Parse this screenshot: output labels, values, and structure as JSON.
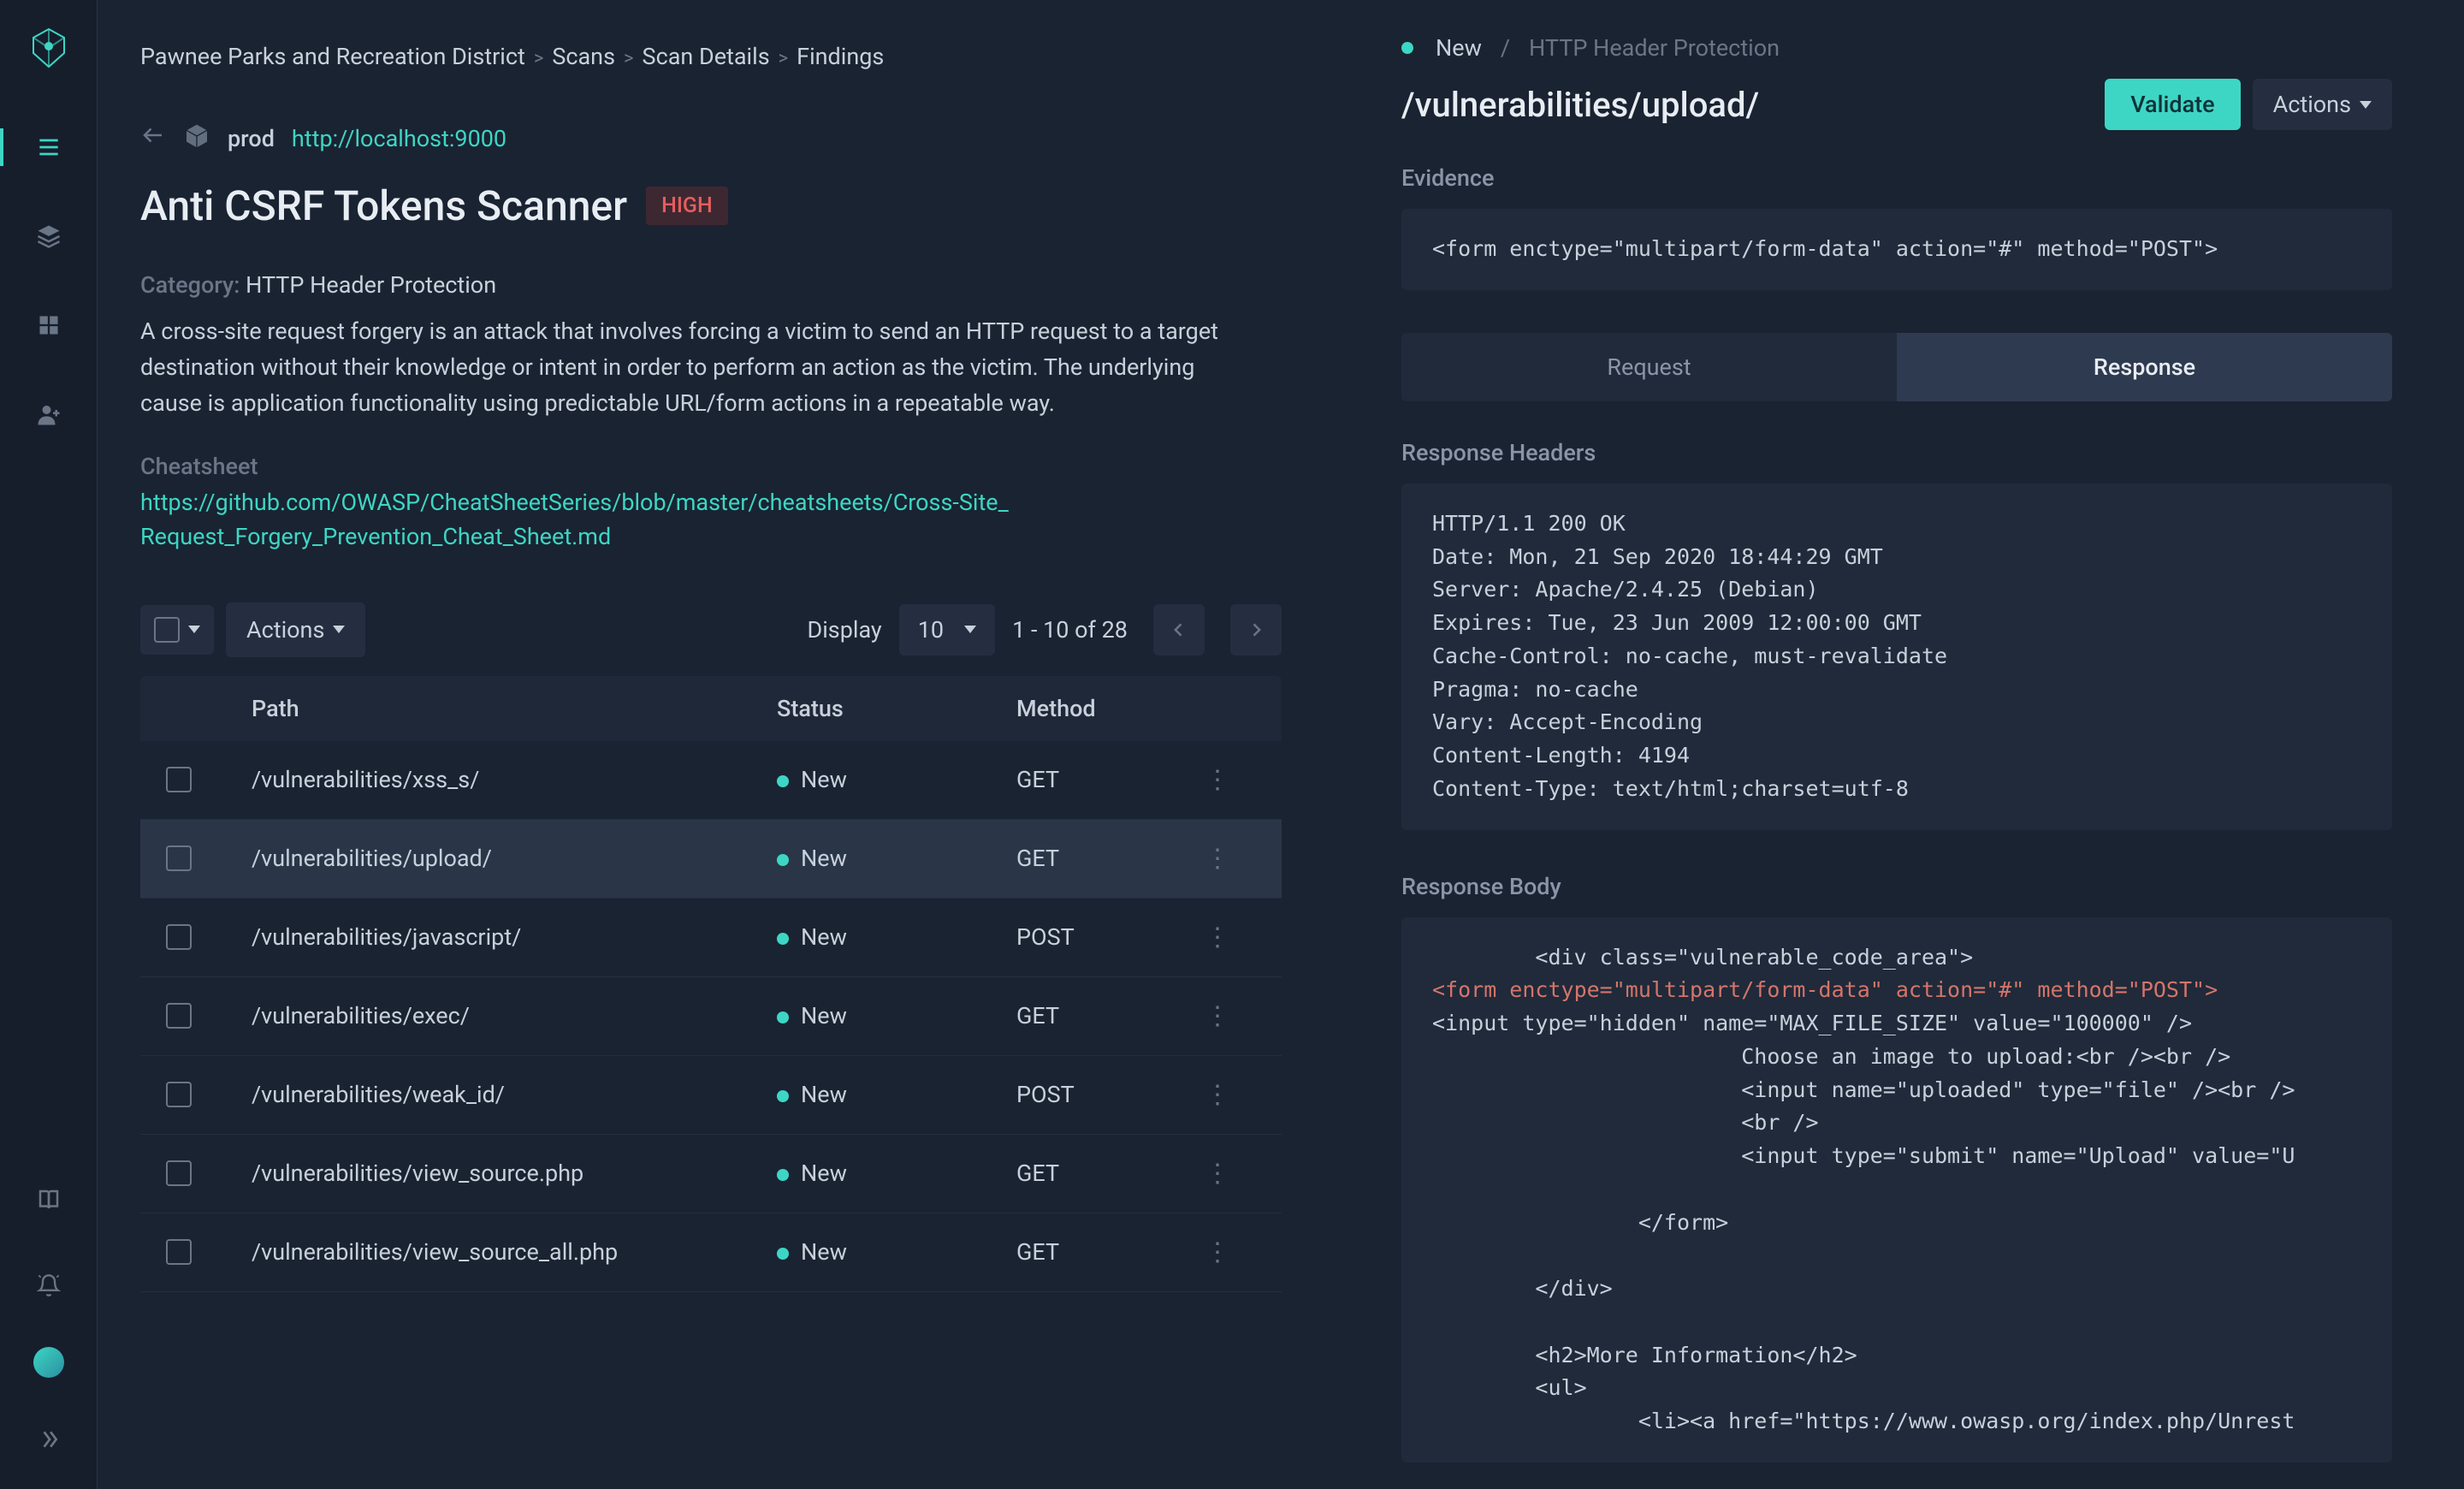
{
  "breadcrumb": [
    "Pawnee Parks and Recreation District",
    "Scans",
    "Scan Details",
    "Findings"
  ],
  "env": {
    "name": "prod",
    "url": "http://localhost:9000"
  },
  "title": "Anti CSRF Tokens Scanner",
  "severity": "HIGH",
  "category_label": "Category:",
  "category_value": "HTTP Header Protection",
  "description": "A cross-site request forgery is an attack that involves forcing a victim to send an HTTP request to a target destination without their knowledge or intent in order to perform an action as the victim. The underlying cause is application functionality using predictable URL/form actions in a repeatable way.",
  "cheatsheet_label": "Cheatsheet",
  "cheatsheet_url": "https://github.com/OWASP/CheatSheetSeries/blob/master/cheatsheets/Cross-Site_Request_Forgery_Prevention_Cheat_Sheet.md",
  "actions_label": "Actions",
  "display_label": "Display",
  "display_value": "10",
  "pager_text": "1 - 10 of 28",
  "table": {
    "headers": {
      "path": "Path",
      "status": "Status",
      "method": "Method"
    },
    "rows": [
      {
        "path": "/vulnerabilities/xss_s/",
        "status": "New",
        "method": "GET",
        "selected": false
      },
      {
        "path": "/vulnerabilities/upload/",
        "status": "New",
        "method": "GET",
        "selected": true
      },
      {
        "path": "/vulnerabilities/javascript/",
        "status": "New",
        "method": "POST",
        "selected": false
      },
      {
        "path": "/vulnerabilities/exec/",
        "status": "New",
        "method": "GET",
        "selected": false
      },
      {
        "path": "/vulnerabilities/weak_id/",
        "status": "New",
        "method": "POST",
        "selected": false
      },
      {
        "path": "/vulnerabilities/view_source.php",
        "status": "New",
        "method": "GET",
        "selected": false
      },
      {
        "path": "/vulnerabilities/view_source_all.php",
        "status": "New",
        "method": "GET",
        "selected": false
      }
    ]
  },
  "detail": {
    "status": "New",
    "category": "HTTP Header Protection",
    "title": "/vulnerabilities/upload/",
    "validate_label": "Validate",
    "actions_label": "Actions",
    "evidence_label": "Evidence",
    "evidence_code": "<form enctype=\"multipart/form-data\" action=\"#\" method=\"POST\">",
    "tabs": {
      "request": "Request",
      "response": "Response"
    },
    "active_tab": "response",
    "response_headers_label": "Response Headers",
    "response_headers": "HTTP/1.1 200 OK\nDate: Mon, 21 Sep 2020 18:44:29 GMT\nServer: Apache/2.4.25 (Debian)\nExpires: Tue, 23 Jun 2009 12:00:00 GMT\nCache-Control: no-cache, must-revalidate\nPragma: no-cache\nVary: Accept-Encoding\nContent-Length: 4194\nContent-Type: text/html;charset=utf-8",
    "response_body_label": "Response Body",
    "response_body_pre": "        <div class=\"vulnerable_code_area\">",
    "response_body_highlight": "<form enctype=\"multipart/form-data\" action=\"#\" method=\"POST\">",
    "response_body_post": "<input type=\"hidden\" name=\"MAX_FILE_SIZE\" value=\"100000\" />\n                        Choose an image to upload:<br /><br />\n                        <input name=\"uploaded\" type=\"file\" /><br />\n                        <br />\n                        <input type=\"submit\" name=\"Upload\" value=\"U\n\n                </form>\n\n        </div>\n\n        <h2>More Information</h2>\n        <ul>\n                <li><a href=\"https://www.owasp.org/index.php/Unrest"
  }
}
